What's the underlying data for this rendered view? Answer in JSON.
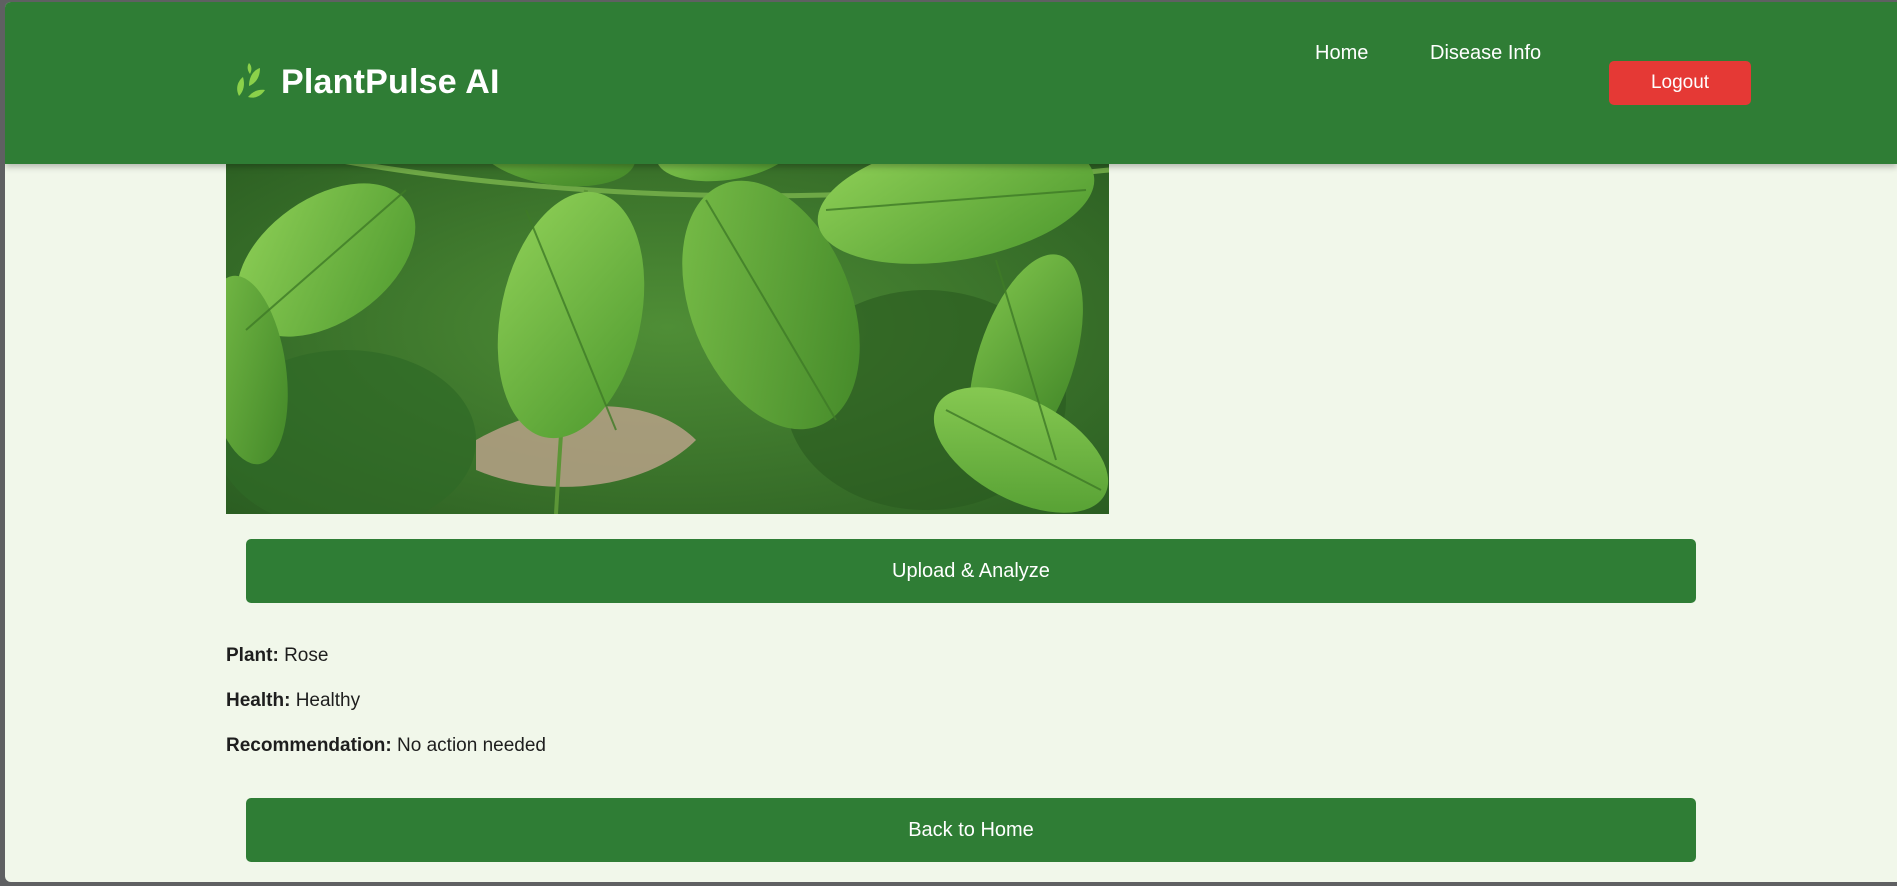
{
  "app": {
    "title": "PlantPulse AI",
    "icon": "leaf-sprout-icon"
  },
  "nav": {
    "home": "Home",
    "disease_info": "Disease Info",
    "logout": "Logout"
  },
  "colors": {
    "primary": "#2f7d35",
    "danger": "#e53935",
    "background": "#f1f7ea",
    "leaf_accent": "#8bd14a"
  },
  "main": {
    "image": "rose-leaves-photo",
    "upload_button": "Upload & Analyze",
    "results": {
      "plant_label": "Plant:",
      "plant_value": "Rose",
      "health_label": "Health:",
      "health_value": "Healthy",
      "recommendation_label": "Recommendation:",
      "recommendation_value": "No action needed"
    },
    "back_button": "Back to Home"
  }
}
